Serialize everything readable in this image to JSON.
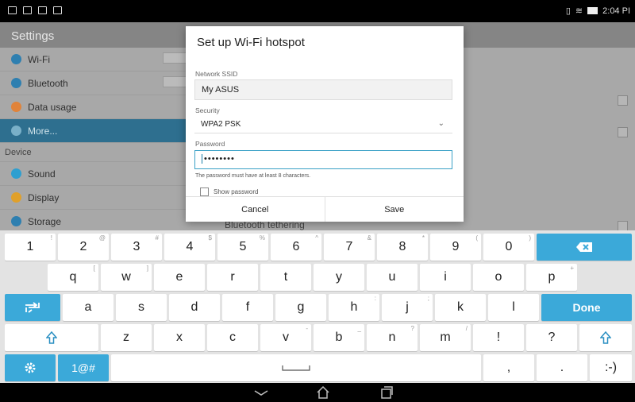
{
  "status_bar": {
    "time": "2:04 PI"
  },
  "settings": {
    "title": "Settings",
    "rows": [
      {
        "label": "Wi-Fi",
        "color": "#2e7fb0"
      },
      {
        "label": "Bluetooth",
        "color": "#2e7fb0"
      },
      {
        "label": "Data usage",
        "color": "#e0833a"
      },
      {
        "label": "More...",
        "color": "#7ab0c8",
        "selected": true
      }
    ],
    "section": "Device",
    "device_rows": [
      {
        "label": "Sound",
        "color": "#2e9fd0"
      },
      {
        "label": "Display",
        "color": "#e0a02a"
      },
      {
        "label": "Storage",
        "color": "#2e7fb0"
      }
    ],
    "peek": "Bluetooth tethering"
  },
  "dialog": {
    "title": "Set up Wi-Fi hotspot",
    "ssid_label": "Network SSID",
    "ssid_value": "My ASUS",
    "security_label": "Security",
    "security_value": "WPA2 PSK",
    "password_label": "Password",
    "password_value": "••••••••",
    "hint": "The password must have at least 8 characters.",
    "show_password": "Show password",
    "cancel": "Cancel",
    "save": "Save"
  },
  "keyboard": {
    "row1": [
      {
        "main": "1",
        "alt": "!"
      },
      {
        "main": "2",
        "alt": "@"
      },
      {
        "main": "3",
        "alt": "#"
      },
      {
        "main": "4",
        "alt": "$"
      },
      {
        "main": "5",
        "alt": "%"
      },
      {
        "main": "6",
        "alt": "^"
      },
      {
        "main": "7",
        "alt": "&"
      },
      {
        "main": "8",
        "alt": "*"
      },
      {
        "main": "9",
        "alt": "("
      },
      {
        "main": "0",
        "alt": ")"
      }
    ],
    "row2": [
      {
        "main": "q",
        "alt": "["
      },
      {
        "main": "w",
        "alt": "]"
      },
      {
        "main": "e",
        "alt": ""
      },
      {
        "main": "r",
        "alt": ""
      },
      {
        "main": "t",
        "alt": ""
      },
      {
        "main": "y",
        "alt": ""
      },
      {
        "main": "u",
        "alt": ""
      },
      {
        "main": "i",
        "alt": ""
      },
      {
        "main": "o",
        "alt": ""
      },
      {
        "main": "p",
        "alt": "+"
      }
    ],
    "row3": [
      {
        "main": "a",
        "alt": ""
      },
      {
        "main": "s",
        "alt": ""
      },
      {
        "main": "d",
        "alt": ""
      },
      {
        "main": "f",
        "alt": ""
      },
      {
        "main": "g",
        "alt": ""
      },
      {
        "main": "h",
        "alt": ":"
      },
      {
        "main": "j",
        "alt": ";"
      },
      {
        "main": "k",
        "alt": ""
      },
      {
        "main": "l",
        "alt": ""
      }
    ],
    "row4": [
      {
        "main": "z",
        "alt": ""
      },
      {
        "main": "x",
        "alt": ""
      },
      {
        "main": "c",
        "alt": ""
      },
      {
        "main": "v",
        "alt": "-"
      },
      {
        "main": "b",
        "alt": "_"
      },
      {
        "main": "n",
        "alt": "?"
      },
      {
        "main": "m",
        "alt": "/"
      },
      {
        "main": "!",
        "alt": ""
      },
      {
        "main": "?",
        "alt": ""
      }
    ],
    "done": "Done",
    "symbols": "1@#",
    "comma": ",",
    "period": ".",
    "emoticon": ":-)"
  }
}
